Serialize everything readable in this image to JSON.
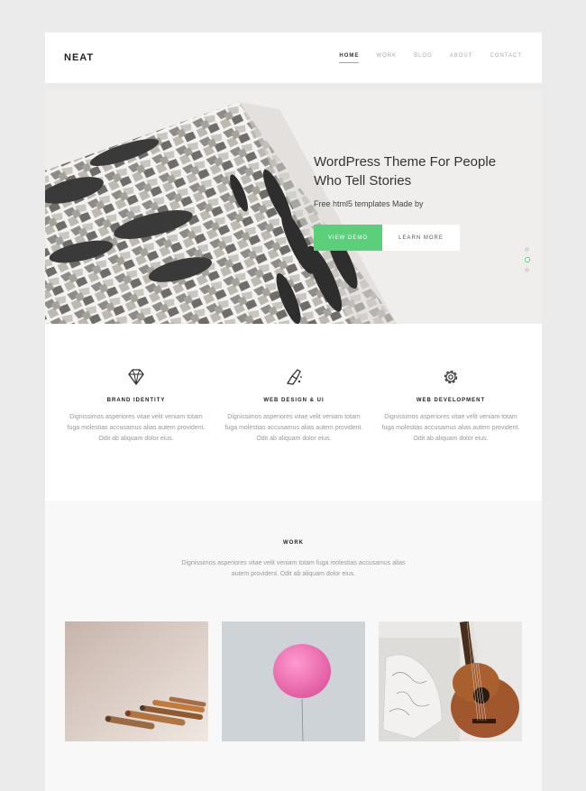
{
  "header": {
    "logo": "NEAT",
    "nav": [
      {
        "label": "HOME",
        "active": true
      },
      {
        "label": "WORK"
      },
      {
        "label": "BLOG"
      },
      {
        "label": "ABOUT"
      },
      {
        "label": "CONTACT"
      }
    ]
  },
  "hero": {
    "title": "WordPress Theme For People Who Tell Stories",
    "subtitle": "Free html5 templates Made by",
    "primary_button": "VIEW DEMO",
    "secondary_button": "LEARN MORE",
    "slides": 3,
    "active_slide": 2
  },
  "features": [
    {
      "icon": "diamond-icon",
      "title": "BRAND IDENTITY",
      "text": "Dignissimos asperiores vitae velit veniam totam fuga molestias accusamus alias autem provident. Odit ab aliquam dolor eius."
    },
    {
      "icon": "paint-brush-icon",
      "title": "WEB DESIGN & UI",
      "text": "Dignissimos asperiores vitae velit veniam totam fuga molestias accusamus alias autem provident. Odit ab aliquam dolor eius."
    },
    {
      "icon": "gear-icon",
      "title": "WEB DEVELOPMENT",
      "text": "Dignissimos asperiores vitae velit veniam totam fuga molestias accusamus alias autem provident. Odit ab aliquam dolor eius."
    }
  ],
  "work": {
    "title": "WORK",
    "text": "Dignissimos asperiores vitae velit veniam totam fuga molestias accusamus alias autem provident. Odit ab aliquam dolor eius.",
    "items": [
      {
        "name": "pencils-image"
      },
      {
        "name": "pink-balloon-image"
      },
      {
        "name": "guitar-image"
      }
    ]
  },
  "colors": {
    "accent": "#5ccf7b",
    "background": "#ebebeb"
  }
}
